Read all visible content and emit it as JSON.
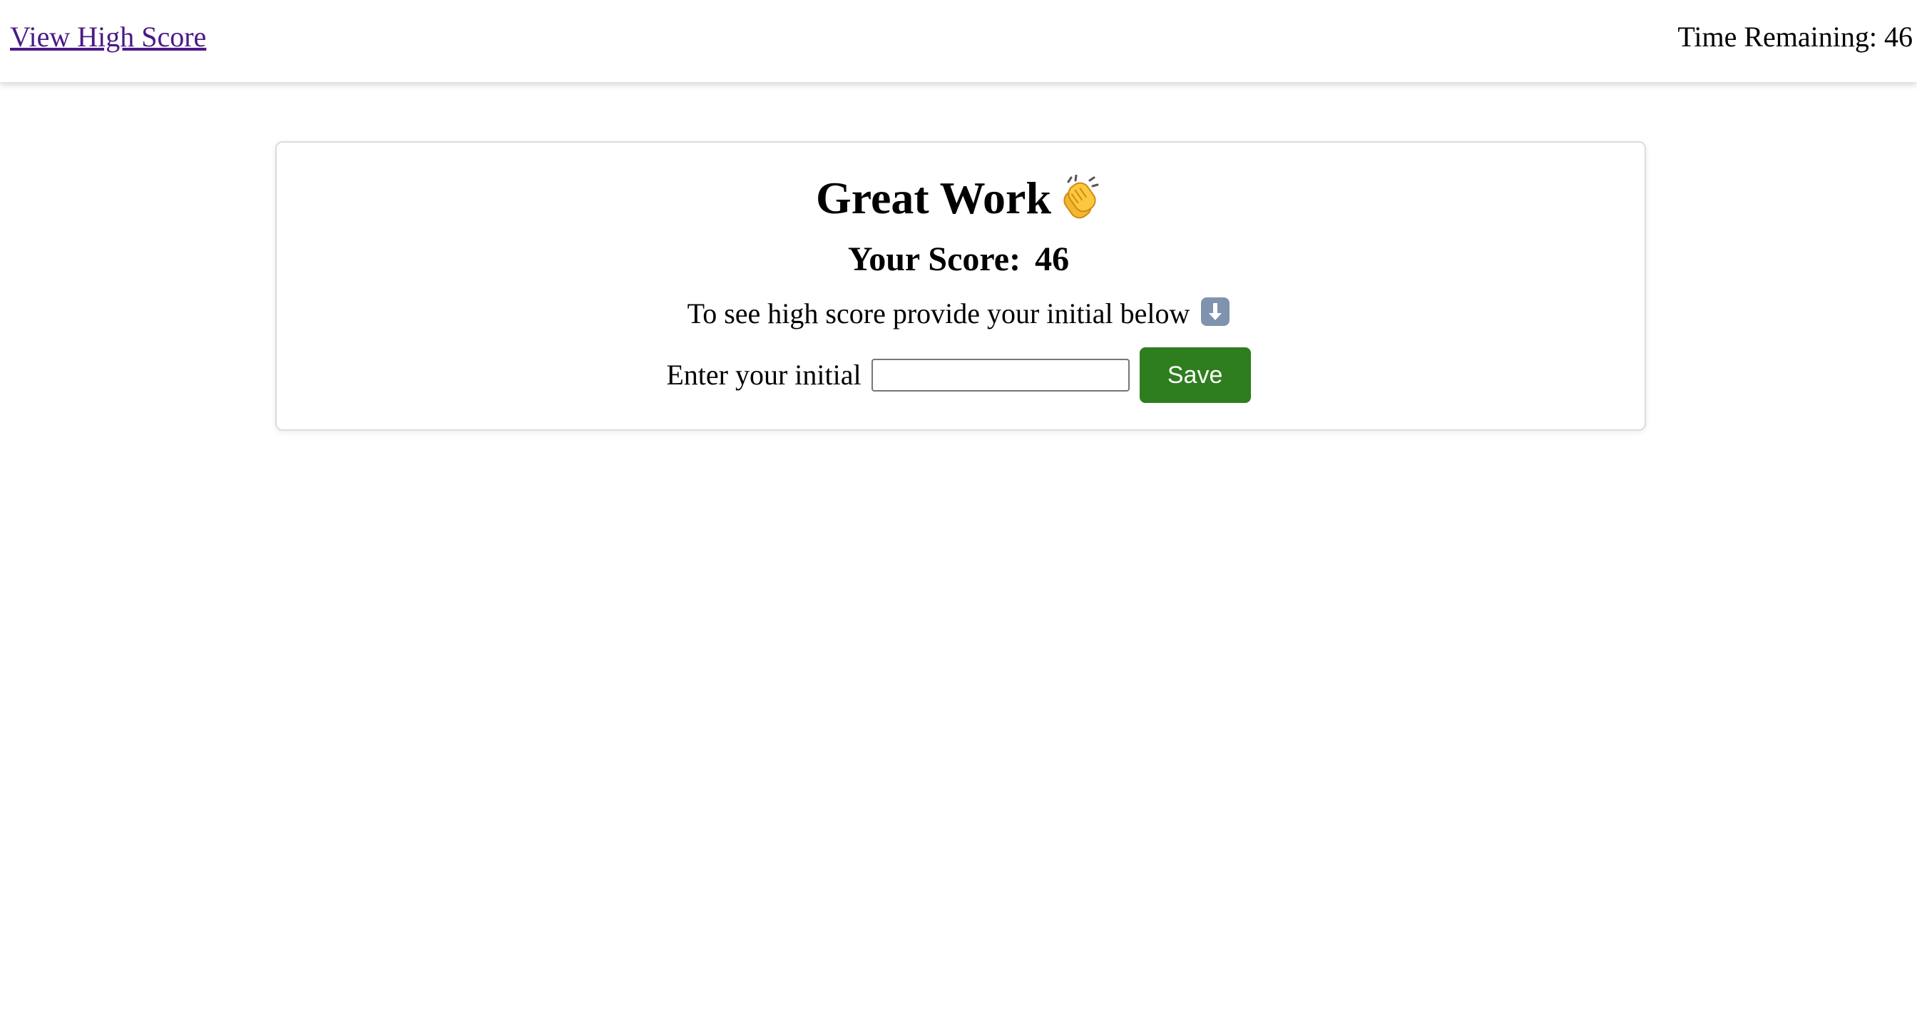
{
  "header": {
    "high_score_link": "View High Score",
    "timer_text": "Time Remaining: 46"
  },
  "result": {
    "title": "Great Work",
    "title_icon": "clapping-hands-icon",
    "score_label": "Your Score:",
    "score_value": "46",
    "hint": "To see high score provide your initial below",
    "hint_icon": "down-arrow-icon"
  },
  "form": {
    "initial_label": "Enter your initial",
    "initial_value": "",
    "save_label": "Save"
  },
  "colors": {
    "link": "#4b1a86",
    "save_button": "#2e7d1e",
    "down_arrow_bg": "#7f93ae"
  }
}
